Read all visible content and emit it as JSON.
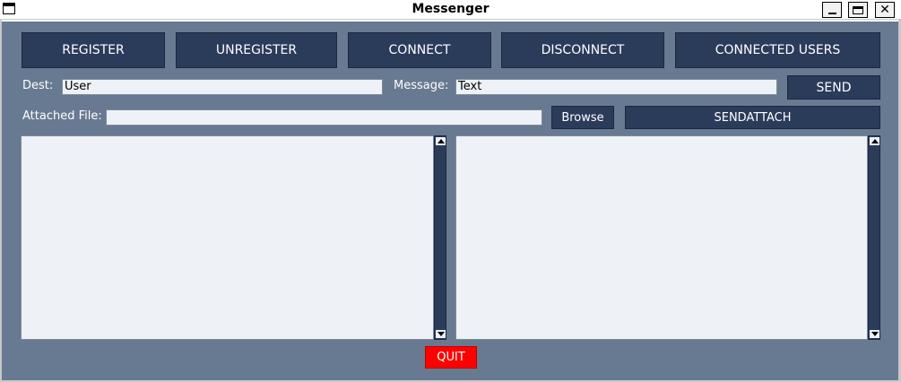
{
  "window": {
    "title": "Messenger"
  },
  "toolbar": {
    "register_label": "REGISTER",
    "unregister_label": "UNREGISTER",
    "connect_label": "CONNECT",
    "disconnect_label": "DISCONNECT",
    "connected_users_label": "CONNECTED USERS"
  },
  "message_row": {
    "dest_label": "Dest:",
    "dest_value": "User",
    "message_label": "Message:",
    "message_value": "Text",
    "send_label": "SEND"
  },
  "attach_row": {
    "attached_file_label": "Attached File:",
    "attached_file_value": "",
    "browse_label": "Browse",
    "sendattach_label": "SENDATTACH"
  },
  "footer": {
    "quit_label": "QUIT"
  },
  "colors": {
    "background": "#687a91",
    "button": "#2b3b5a",
    "field": "#eef1f6",
    "quit": "#ff0000"
  }
}
